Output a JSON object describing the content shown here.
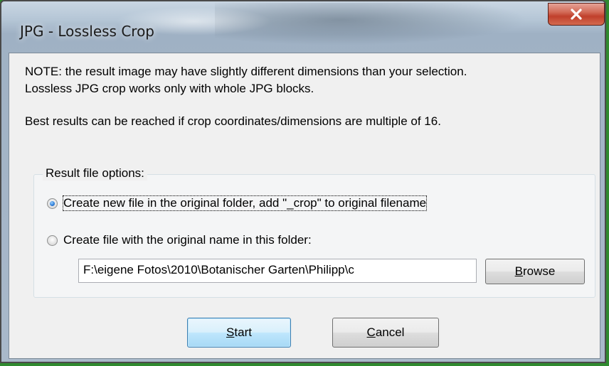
{
  "window": {
    "title": "JPG - Lossless Crop",
    "close_icon": "close-icon",
    "close_color": "#c7432e"
  },
  "note": {
    "line1": "NOTE: the result image may have slightly different dimensions than your selection.",
    "line2": "Lossless JPG crop works only with whole JPG blocks.",
    "best": "Best results can be reached if crop coordinates/dimensions are multiple of 16."
  },
  "options": {
    "group_label": "Result file options:",
    "option1": {
      "label": "Create new file in the original folder, add \"_crop\" to original filename",
      "checked": true
    },
    "option2": {
      "label": "Create file with the original name in this folder:",
      "checked": false
    },
    "folder_value": "F:\\eigene Fotos\\2010\\Botanischer Garten\\Philipp\\c",
    "browse": {
      "mnemonic": "B",
      "rest": "rowse"
    }
  },
  "buttons": {
    "start": {
      "mnemonic": "S",
      "rest": "tart"
    },
    "cancel": {
      "mnemonic": "C",
      "rest": "ancel"
    }
  }
}
